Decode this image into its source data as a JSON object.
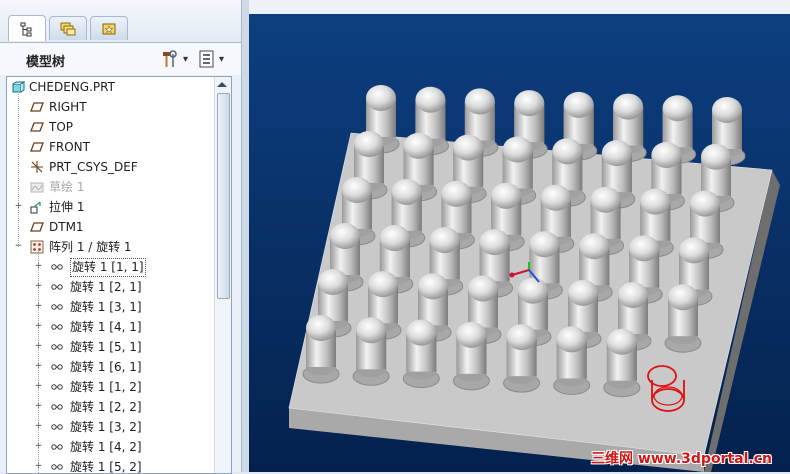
{
  "panel": {
    "title": "模型树",
    "tabs": [
      {
        "name": "model-tree-tab",
        "icon": "model-tree-icon",
        "active": true
      },
      {
        "name": "folder-browser-tab",
        "icon": "folder-icon",
        "active": false
      },
      {
        "name": "favorites-tab",
        "icon": "favorites-icon",
        "active": false
      }
    ],
    "tools": [
      {
        "name": "settings-tool",
        "icon": "hammer-wrench-icon",
        "dropdown": "▾"
      },
      {
        "name": "show-tool",
        "icon": "list-icon",
        "dropdown": "▾"
      }
    ]
  },
  "tree": {
    "items": [
      {
        "label": "CHEDENG.PRT",
        "icon": "part-icon",
        "level": 0,
        "expander": "",
        "style": "normal"
      },
      {
        "label": "RIGHT",
        "icon": "datum-plane-icon",
        "level": 1,
        "expander": "",
        "style": "normal"
      },
      {
        "label": "TOP",
        "icon": "datum-plane-icon",
        "level": 1,
        "expander": "",
        "style": "normal"
      },
      {
        "label": "FRONT",
        "icon": "datum-plane-icon",
        "level": 1,
        "expander": "",
        "style": "normal"
      },
      {
        "label": "PRT_CSYS_DEF",
        "icon": "coordinate-system-icon",
        "level": 1,
        "expander": "",
        "style": "normal"
      },
      {
        "label": "草绘 1",
        "icon": "sketch-icon",
        "level": 1,
        "expander": "",
        "style": "dim"
      },
      {
        "label": "拉伸 1",
        "icon": "extrude-icon",
        "level": 1,
        "expander": "+",
        "style": "normal"
      },
      {
        "label": "DTM1",
        "icon": "datum-plane-icon",
        "level": 1,
        "expander": "",
        "style": "normal"
      },
      {
        "label": "阵列 1 / 旋转 1",
        "icon": "pattern-icon",
        "level": 1,
        "expander": "−",
        "style": "normal"
      },
      {
        "label": "旋转 1 [1, 1]",
        "icon": "revolve-icon",
        "level": 2,
        "expander": "+",
        "style": "selected"
      },
      {
        "label": "旋转 1 [2, 1]",
        "icon": "revolve-icon",
        "level": 2,
        "expander": "+",
        "style": "normal"
      },
      {
        "label": "旋转 1 [3, 1]",
        "icon": "revolve-icon",
        "level": 2,
        "expander": "+",
        "style": "normal"
      },
      {
        "label": "旋转 1 [4, 1]",
        "icon": "revolve-icon",
        "level": 2,
        "expander": "+",
        "style": "normal"
      },
      {
        "label": "旋转 1 [5, 1]",
        "icon": "revolve-icon",
        "level": 2,
        "expander": "+",
        "style": "normal"
      },
      {
        "label": "旋转 1 [6, 1]",
        "icon": "revolve-icon",
        "level": 2,
        "expander": "+",
        "style": "normal"
      },
      {
        "label": "旋转 1 [1, 2]",
        "icon": "revolve-icon",
        "level": 2,
        "expander": "+",
        "style": "normal"
      },
      {
        "label": "旋转 1 [2, 2]",
        "icon": "revolve-icon",
        "level": 2,
        "expander": "+",
        "style": "normal"
      },
      {
        "label": "旋转 1 [3, 2]",
        "icon": "revolve-icon",
        "level": 2,
        "expander": "+",
        "style": "normal"
      },
      {
        "label": "旋转 1 [4, 2]",
        "icon": "revolve-icon",
        "level": 2,
        "expander": "+",
        "style": "normal"
      },
      {
        "label": "旋转 1 [5, 2]",
        "icon": "revolve-icon",
        "level": 2,
        "expander": "+",
        "style": "normal"
      }
    ]
  },
  "viewport": {
    "model": "pin-grid-plate",
    "pin_rows": 6,
    "pin_cols": 8,
    "highlighted_pin": "red-outline",
    "watermark": "三维网 www.3dportal.cn",
    "colors": {
      "background_top": "#0d3f80",
      "background_bottom": "#04214d",
      "highlight": "#e01010",
      "body": "#c9c9c9"
    }
  }
}
